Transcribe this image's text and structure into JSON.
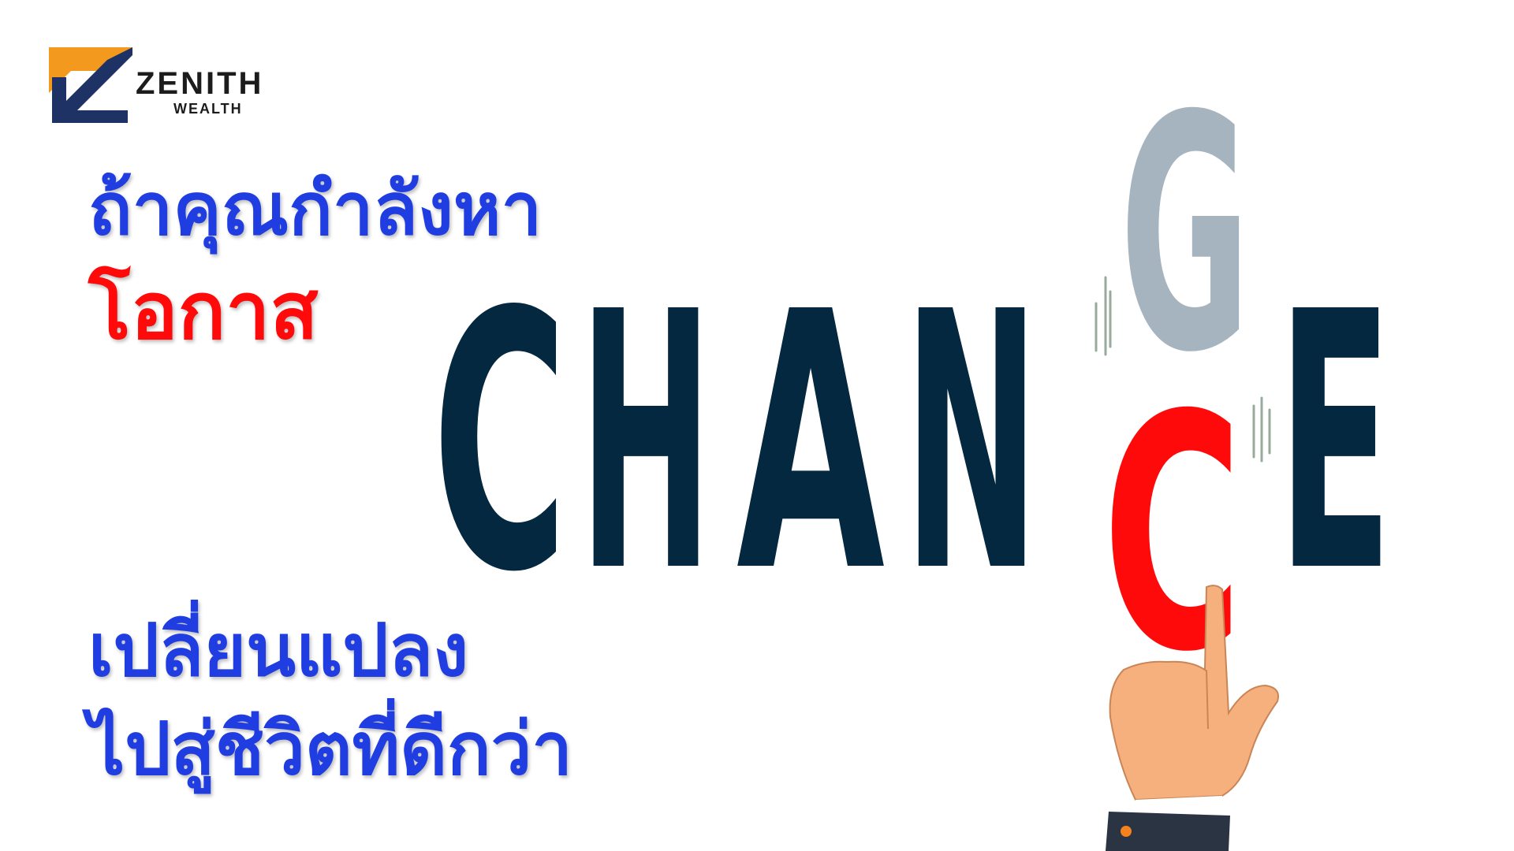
{
  "logo": {
    "name": "ZENITH",
    "sub": "WEALTH",
    "colors": {
      "orange": "#f39a1e",
      "navy": "#1e3265"
    }
  },
  "headline": {
    "line1": "ถ้าคุณกำลังหา",
    "line2": "โอกาส",
    "line3": "เปลี่ยนแปลง",
    "line4": "ไปสู่ชีวิตที่ดีกว่า"
  },
  "wordplay": {
    "letters": [
      "C",
      "H",
      "A",
      "N",
      "E"
    ],
    "lifted_letter": "G",
    "inserted_letter": "C",
    "colors": {
      "main": "#04283f",
      "lifted": "#a5b4be",
      "inserted": "#ff0a0a"
    }
  },
  "colors": {
    "thai_blue": "#1f3de0",
    "thai_red": "#ff0a0a",
    "background": "#ffffff"
  }
}
